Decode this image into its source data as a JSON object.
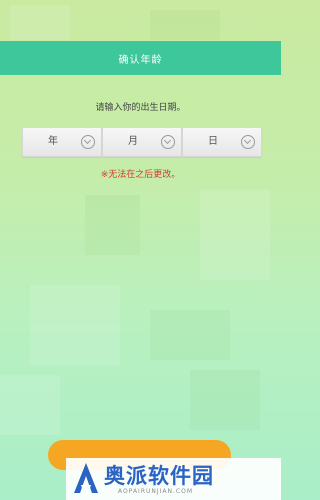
{
  "header": {
    "title": "确认年龄"
  },
  "prompt": "请输入你的出生日期。",
  "selectors": [
    {
      "label": "年"
    },
    {
      "label": "月"
    },
    {
      "label": "日"
    }
  ],
  "warning": "※无法在之后更改。",
  "watermark": {
    "text": "奥派软件园",
    "subtext": "AOPAIRUNJIAN.COM"
  },
  "colors": {
    "header": "#3fc79c",
    "warning": "#d23b2b",
    "confirm_button": "#f5a623",
    "watermark": "#2b63c4"
  }
}
